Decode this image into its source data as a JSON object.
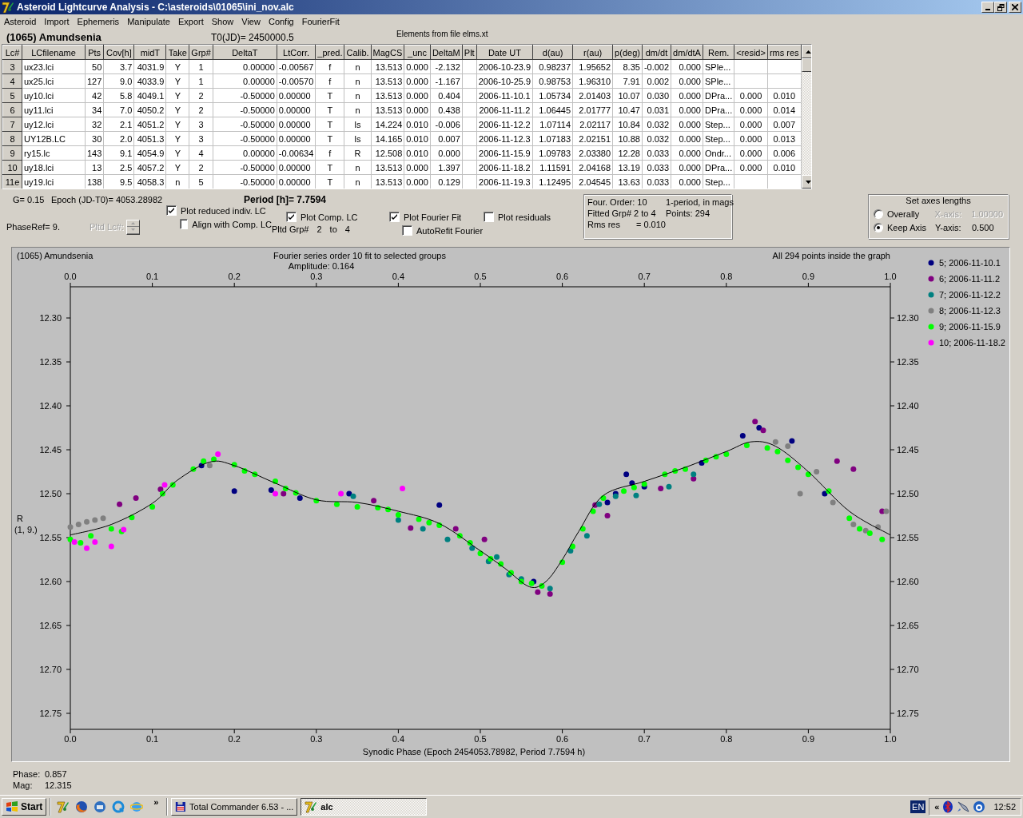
{
  "window": {
    "title": "Asteroid Lightcurve Analysis - C:\\asteroids\\01065\\ini_nov.alc"
  },
  "menu": [
    "Asteroid",
    "Import",
    "Ephemeris",
    "Manipulate",
    "Export",
    "Show",
    "View",
    "Config",
    "FourierFit"
  ],
  "header": {
    "asteroid": "(1065) Amundsenia",
    "t0": "T0(JD)= 2450000.5",
    "elements": "Elements from file elms.xt"
  },
  "table": {
    "columns": [
      "Lc#",
      "LCfilename",
      "Pts",
      "Cov[h]",
      "midT",
      "Take",
      "Grp#",
      "DeltaT",
      "LtCorr.",
      "_pred.",
      "Calib.",
      "MagCS",
      "_unc",
      "DeltaM",
      "Plt",
      "Date UT",
      "d(au)",
      "r(au)",
      "p(deg)",
      "dm/dt",
      "dm/dtA",
      "Rem.",
      "<resid>",
      "rms res"
    ],
    "rows": [
      {
        "cells": [
          "3",
          "ux23.lci",
          "50",
          "3.7",
          "4031.9",
          "Y",
          "1",
          "0.00000",
          "-0.00567",
          "f",
          "n",
          "13.513",
          "0.000",
          "-2.132",
          null,
          "2006-10-23.9",
          "0.98237",
          "1.95652",
          "8.35",
          "-0.002",
          "0.000",
          "SPle...",
          null,
          null
        ]
      },
      {
        "cells": [
          "4",
          "ux25.lci",
          "127",
          "9.0",
          "4033.9",
          "Y",
          "1",
          "0.00000",
          "-0.00570",
          "f",
          "n",
          "13.513",
          "0.000",
          "-1.167",
          null,
          "2006-10-25.9",
          "0.98753",
          "1.96310",
          "7.91",
          "0.002",
          "0.000",
          "SPle...",
          null,
          null
        ]
      },
      {
        "cells": [
          "5",
          "uy10.lci",
          "42",
          "5.8",
          "4049.1",
          "Y",
          "2",
          "-0.50000",
          "0.00000",
          "T",
          "n",
          "13.513",
          "0.000",
          "0.404",
          null,
          "2006-11-10.1",
          "1.05734",
          "2.01403",
          "10.07",
          "0.030",
          "0.000",
          "DPra...",
          "0.000",
          "0.010"
        ]
      },
      {
        "cells": [
          "6",
          "uy11.lci",
          "34",
          "7.0",
          "4050.2",
          "Y",
          "2",
          "-0.50000",
          "0.00000",
          "T",
          "n",
          "13.513",
          "0.000",
          "0.438",
          null,
          "2006-11-11.2",
          "1.06445",
          "2.01777",
          "10.47",
          "0.031",
          "0.000",
          "DPra...",
          "0.000",
          "0.014"
        ]
      },
      {
        "cells": [
          "7",
          "uy12.lci",
          "32",
          "2.1",
          "4051.2",
          "Y",
          "3",
          "-0.50000",
          "0.00000",
          "T",
          "ls",
          "14.224",
          "0.010",
          "-0.006",
          null,
          "2006-11-12.2",
          "1.07114",
          "2.02117",
          "10.84",
          "0.032",
          "0.000",
          "Step...",
          "0.000",
          "0.007"
        ]
      },
      {
        "cells": [
          "8",
          "UY12B.LC",
          "30",
          "2.0",
          "4051.3",
          "Y",
          "3",
          "-0.50000",
          "0.00000",
          "T",
          "ls",
          "14.165",
          "0.010",
          "0.007",
          null,
          "2006-11-12.3",
          "1.07183",
          "2.02151",
          "10.88",
          "0.032",
          "0.000",
          "Step...",
          "0.000",
          "0.013"
        ]
      },
      {
        "cells": [
          "9",
          "ry15.lc",
          "143",
          "9.1",
          "4054.9",
          "Y",
          "4",
          "0.00000",
          "-0.00634",
          "f",
          "R",
          "12.508",
          "0.010",
          "0.000",
          null,
          "2006-11-15.9",
          "1.09783",
          "2.03380",
          "12.28",
          "0.033",
          "0.000",
          "Ondr...",
          "0.000",
          "0.006"
        ]
      },
      {
        "cells": [
          "10",
          "uy18.lci",
          "13",
          "2.5",
          "4057.2",
          "Y",
          "2",
          "-0.50000",
          "0.00000",
          "T",
          "n",
          "13.513",
          "0.000",
          "1.397",
          null,
          "2006-11-18.2",
          "1.11591",
          "2.04168",
          "13.19",
          "0.033",
          "0.000",
          "DPra...",
          "0.000",
          "0.010"
        ]
      },
      {
        "cells": [
          "11e",
          "uy19.lci",
          "138",
          "9.5",
          "4058.3",
          "n",
          "5",
          "-0.50000",
          "0.00000",
          "T",
          "n",
          "13.513",
          "0.000",
          "0.129",
          null,
          "2006-11-19.3",
          "1.12495",
          "2.04545",
          "13.63",
          "0.033",
          "0.000",
          "Step...",
          null,
          null
        ]
      }
    ]
  },
  "controls": {
    "g": "G= 0.15",
    "epoch": "Epoch (JD-T0)= 4053.28982",
    "period": "Period [h]= 7.7594",
    "phase_ref": "PhaseRef= 9.",
    "pltd_lc": {
      "label": "Pltd Lc#:",
      "disabled": true
    },
    "checkboxes": [
      {
        "label": "Plot reduced indiv. LC",
        "checked": true
      },
      {
        "label": "Align with Comp. LC",
        "checked": false
      },
      {
        "label": "Plot Comp. LC",
        "checked": true
      },
      {
        "label": "Plot Fourier Fit",
        "checked": true
      },
      {
        "label": "AutoRefit Fourier",
        "checked": false
      },
      {
        "label": "Plot residuals",
        "checked": false
      }
    ],
    "pltd_grp": {
      "label": "Pltd Grp#",
      "from": "2",
      "to_label": "to",
      "to": "4"
    }
  },
  "fit_info": {
    "order": "Four. Order: 10",
    "mode": "1-period, in mags",
    "groups": "Fitted Grp# 2 to 4",
    "points": "Points: 294",
    "rms_label": "Rms res",
    "rms_value": "= 0.010"
  },
  "axes_lengths": {
    "title": "Set axes lengths",
    "options": [
      {
        "label": "Overally",
        "selected": false,
        "axis": "X-axis:",
        "value": "1.00000",
        "disabled": true
      },
      {
        "label": "Keep Axis",
        "selected": true,
        "axis": "Y-axis:",
        "value": "0.500",
        "disabled": false
      }
    ]
  },
  "plot": {
    "object": "(1065) Amundsenia",
    "subtitle": "Fourier series order 10 fit to selected groups",
    "amplitude": "Amplitude: 0.164",
    "status": "All 294 points inside the graph",
    "ylabel_note": "(1, 9.)",
    "chart_data": {
      "type": "scatter",
      "xlabel": "Synodic Phase (Epoch 2454053.78982, Period 7.7594 h)",
      "ylabel": "R",
      "xlim": [
        0,
        1
      ],
      "ylim": [
        12.7682,
        12.2645
      ],
      "legend": true,
      "xticks": [
        {
          "value": 0,
          "label": "0.0"
        },
        {
          "value": 0.1,
          "label": "0.1"
        },
        {
          "value": 0.2,
          "label": "0.2"
        },
        {
          "value": 0.3,
          "label": "0.3"
        },
        {
          "value": 0.4,
          "label": "0.4"
        },
        {
          "value": 0.5,
          "label": "0.5"
        },
        {
          "value": 0.6,
          "label": "0.6"
        },
        {
          "value": 0.7,
          "label": "0.7"
        },
        {
          "value": 0.8,
          "label": "0.8"
        },
        {
          "value": 0.9,
          "label": "0.9"
        },
        {
          "value": 1,
          "label": "1.0"
        }
      ],
      "yticks": [
        {
          "value": 12.3,
          "label": "12.30"
        },
        {
          "value": 12.35,
          "label": "12.35"
        },
        {
          "value": 12.4,
          "label": "12.40"
        },
        {
          "value": 12.45,
          "label": "12.45"
        },
        {
          "value": 12.5,
          "label": "12.50"
        },
        {
          "value": 12.55,
          "label": "12.55"
        },
        {
          "value": 12.6,
          "label": "12.60"
        },
        {
          "value": 12.65,
          "label": "12.65"
        },
        {
          "value": 12.7,
          "label": "12.70"
        },
        {
          "value": 12.75,
          "label": "12.75"
        }
      ],
      "series": [
        {
          "name": "5; 2006-11-10.1",
          "color": "#000080",
          "type": "scatter",
          "x": [
            0.16,
            0.2,
            0.245,
            0.28,
            0.34,
            0.45,
            0.565,
            0.655,
            0.665,
            0.678,
            0.685,
            0.7,
            0.77,
            0.82,
            0.84,
            0.88,
            0.92
          ],
          "values": [
            12.468,
            12.497,
            12.496,
            12.505,
            12.5,
            12.513,
            12.6,
            12.51,
            12.5,
            12.478,
            12.488,
            12.492,
            12.465,
            12.434,
            12.425,
            12.44,
            12.5
          ]
        },
        {
          "name": "6; 2006-11-11.2",
          "color": "#800080",
          "type": "scatter",
          "x": [
            0.06,
            0.08,
            0.11,
            0.26,
            0.37,
            0.415,
            0.47,
            0.505,
            0.57,
            0.585,
            0.64,
            0.655,
            0.72,
            0.76,
            0.835,
            0.845,
            0.935,
            0.955,
            0.99
          ],
          "values": [
            12.512,
            12.505,
            12.495,
            12.5,
            12.508,
            12.539,
            12.54,
            12.552,
            12.612,
            12.614,
            12.513,
            12.525,
            12.494,
            12.483,
            12.418,
            12.428,
            12.463,
            12.472,
            12.52
          ]
        },
        {
          "name": "7; 2006-11-12.2",
          "color": "#008080",
          "type": "scatter",
          "x": [
            0.345,
            0.4,
            0.43,
            0.46,
            0.49,
            0.51,
            0.52,
            0.535,
            0.55,
            0.585,
            0.61,
            0.63,
            0.645,
            0.665,
            0.69,
            0.73,
            0.76
          ],
          "values": [
            12.503,
            12.53,
            12.54,
            12.552,
            12.562,
            12.577,
            12.572,
            12.592,
            12.597,
            12.608,
            12.565,
            12.548,
            12.512,
            12.503,
            12.502,
            12.492,
            12.478
          ]
        },
        {
          "name": "8; 2006-11-12.3",
          "color": "#808080",
          "type": "scatter",
          "x": [
            0,
            0.01,
            0.02,
            0.03,
            0.04,
            0.17,
            0.86,
            0.875,
            0.89,
            0.91,
            0.93,
            0.955,
            0.97,
            0.985,
            0.995
          ],
          "values": [
            12.538,
            12.535,
            12.532,
            12.53,
            12.528,
            12.468,
            12.441,
            12.446,
            12.5,
            12.475,
            12.51,
            12.535,
            12.542,
            12.538,
            12.52
          ]
        },
        {
          "name": "9; 2006-11-15.9",
          "color": "#00ff00",
          "type": "scatter",
          "x": [
            0,
            0.0125,
            0.025,
            0.05,
            0.0625,
            0.075,
            0.1,
            0.1125,
            0.125,
            0.15,
            0.1625,
            0.175,
            0.2,
            0.2125,
            0.225,
            0.25,
            0.2625,
            0.275,
            0.3,
            0.325,
            0.35,
            0.375,
            0.3875,
            0.4,
            0.425,
            0.4375,
            0.45,
            0.475,
            0.4875,
            0.5,
            0.5125,
            0.525,
            0.5375,
            0.55,
            0.5625,
            0.575,
            0.6,
            0.6125,
            0.625,
            0.6375,
            0.65,
            0.675,
            0.6875,
            0.7,
            0.725,
            0.7375,
            0.75,
            0.775,
            0.7875,
            0.8,
            0.825,
            0.85,
            0.8625,
            0.875,
            0.8875,
            0.9,
            0.925,
            0.95,
            0.9625,
            0.975,
            0.99
          ],
          "values": [
            12.552,
            12.556,
            12.548,
            12.54,
            12.543,
            12.527,
            12.515,
            12.5,
            12.49,
            12.472,
            12.463,
            12.461,
            12.467,
            12.474,
            12.478,
            12.486,
            12.494,
            12.499,
            12.508,
            12.512,
            12.515,
            12.516,
            12.518,
            12.524,
            12.529,
            12.533,
            12.536,
            12.548,
            12.556,
            12.568,
            12.574,
            12.58,
            12.59,
            12.6,
            12.602,
            12.605,
            12.578,
            12.56,
            12.54,
            12.52,
            12.505,
            12.497,
            12.493,
            12.489,
            12.478,
            12.474,
            12.472,
            12.462,
            12.458,
            12.455,
            12.445,
            12.448,
            12.452,
            12.462,
            12.47,
            12.478,
            12.497,
            12.528,
            12.54,
            12.545,
            12.552
          ]
        },
        {
          "name": "10; 2006-11-18.2",
          "color": "#ff00ff",
          "type": "scatter",
          "x": [
            0.005,
            0.02,
            0.03,
            0.05,
            0.065,
            0.115,
            0.18,
            0.25,
            0.33,
            0.405
          ],
          "values": [
            12.555,
            12.562,
            12.555,
            12.56,
            12.541,
            12.49,
            12.455,
            12.5,
            12.5,
            12.494
          ]
        },
        {
          "color": "#000000",
          "type": "line",
          "x": [
            0,
            0.05,
            0.1,
            0.13,
            0.17,
            0.2,
            0.25,
            0.3,
            0.35,
            0.4,
            0.45,
            0.5,
            0.53,
            0.56,
            0.58,
            0.6,
            0.62,
            0.65,
            0.7,
            0.75,
            0.8,
            0.83,
            0.86,
            0.9,
            0.95,
            1
          ],
          "values": [
            12.547,
            12.535,
            12.511,
            12.485,
            12.464,
            12.468,
            12.488,
            12.507,
            12.51,
            12.52,
            12.534,
            12.565,
            12.585,
            12.606,
            12.6,
            12.575,
            12.543,
            12.502,
            12.486,
            12.47,
            12.452,
            12.441,
            12.446,
            12.475,
            12.52,
            12.547
          ]
        }
      ]
    }
  },
  "cursor": {
    "phase_label": "Phase:",
    "phase": "0.857",
    "mag_label": "Mag:",
    "mag": "12.315"
  },
  "taskbar": {
    "start": "Start",
    "more": "»",
    "tasks": [
      {
        "label": "Total Commander 6.53 - ...",
        "kind": "floppy",
        "selected": false
      },
      {
        "label": "alc",
        "kind": "logo",
        "selected": true
      }
    ],
    "language": "EN",
    "tray_expand": "«",
    "clock": "12:52"
  }
}
